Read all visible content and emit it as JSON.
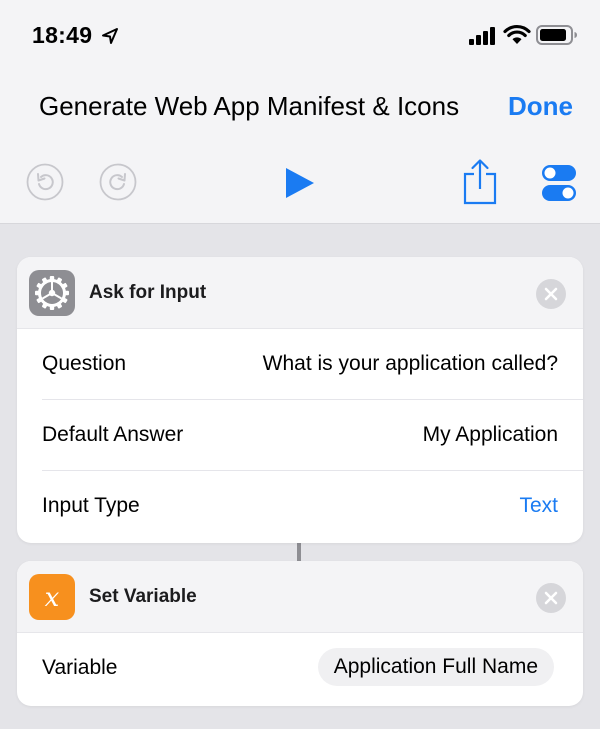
{
  "status_bar": {
    "time": "18:49",
    "icons": [
      "location-arrow-icon",
      "cellular-signal-icon",
      "wifi-icon",
      "battery-icon"
    ]
  },
  "nav": {
    "title": "Generate Web App Manifest & Icons",
    "done_label": "Done"
  },
  "toolbar": {
    "icons": [
      "undo-icon",
      "redo-icon",
      "play-icon",
      "share-icon",
      "toggle-settings-icon"
    ],
    "accent_color": "#1a7bf2"
  },
  "actions": [
    {
      "title": "Ask for Input",
      "icon": "gear-icon",
      "icon_color": "#8e8e93",
      "rows": [
        {
          "label": "Question",
          "value": "What is your application called?"
        },
        {
          "label": "Default Answer",
          "value": "My Application"
        },
        {
          "label": "Input Type",
          "value": "Text"
        }
      ]
    },
    {
      "title": "Set Variable",
      "icon": "variable-x-icon",
      "icon_color": "#f7901e",
      "rows": [
        {
          "label": "Variable",
          "value": "Application Full Name"
        }
      ]
    }
  ]
}
